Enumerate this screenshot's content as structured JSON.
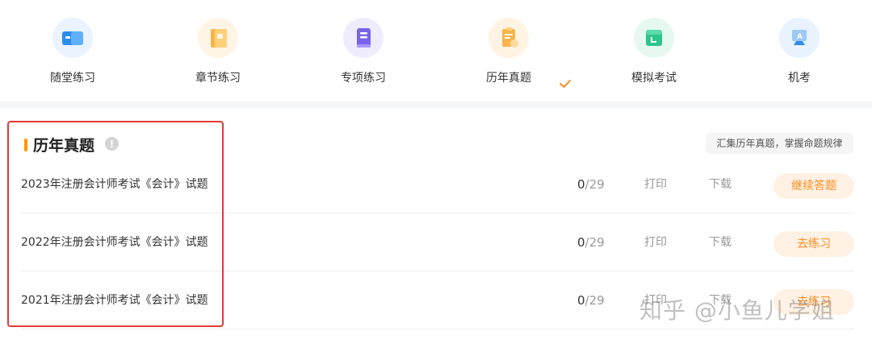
{
  "tabs": [
    {
      "label": "随堂练习",
      "icon": "video-card-icon",
      "active": false
    },
    {
      "label": "章节练习",
      "icon": "book-icon",
      "active": false
    },
    {
      "label": "专项练习",
      "icon": "notebook-icon",
      "active": false
    },
    {
      "label": "历年真题",
      "icon": "exam-paper-icon",
      "active": true
    },
    {
      "label": "模拟考试",
      "icon": "calendar-clock-icon",
      "active": false
    },
    {
      "label": "机考",
      "icon": "computer-exam-icon",
      "active": false
    }
  ],
  "section": {
    "title": "历年真题",
    "tip": "汇集历年真题，掌握命题规律"
  },
  "rows": [
    {
      "title": "2023年注册会计师考试《会计》试题",
      "done": "0",
      "total": "/29",
      "print": "打印",
      "download": "下载",
      "action": "继续答题"
    },
    {
      "title": "2022年注册会计师考试《会计》试题",
      "done": "0",
      "total": "/29",
      "print": "打印",
      "download": "下载",
      "action": "去练习"
    },
    {
      "title": "2021年注册会计师考试《会计》试题",
      "done": "0",
      "total": "/29",
      "print": "打印",
      "download": "下载",
      "action": "去练习"
    }
  ],
  "watermark": "知乎 @小鱼儿学姐",
  "colors": {
    "accent": "#ff8a1f",
    "highlight": "#e53935"
  }
}
